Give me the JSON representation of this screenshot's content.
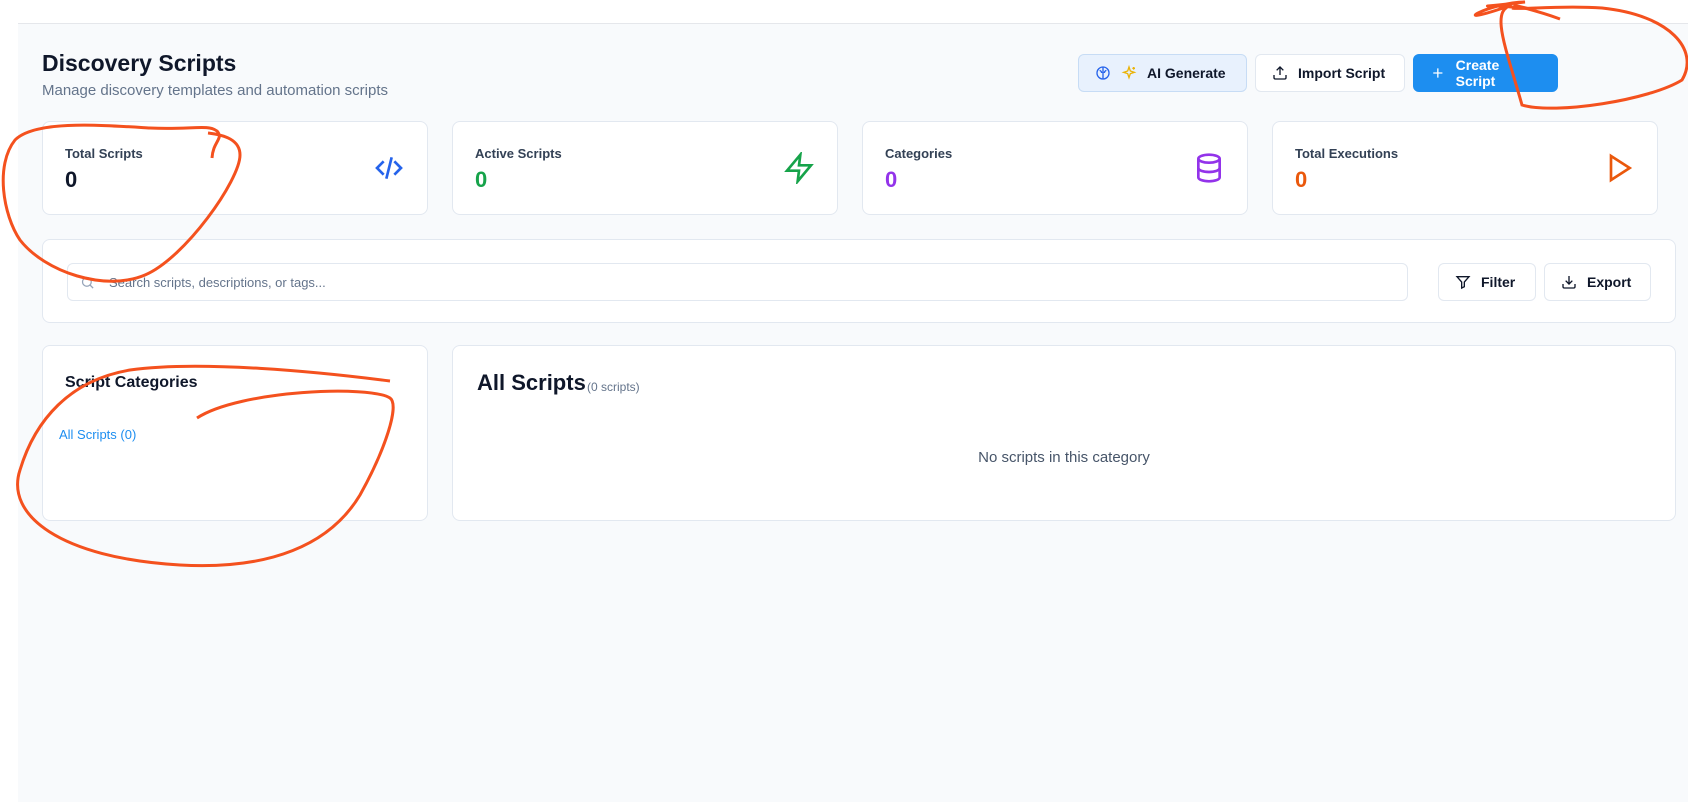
{
  "header": {
    "title": "Discovery Scripts",
    "subtitle": "Manage discovery templates and automation scripts"
  },
  "actions": {
    "ai_generate": "AI Generate",
    "import_script": "Import Script",
    "create_script": "Create Script"
  },
  "stats": [
    {
      "label": "Total Scripts",
      "value": "0",
      "color": "#0f172a",
      "icon": "code-icon",
      "icon_color": "#2563eb"
    },
    {
      "label": "Active Scripts",
      "value": "0",
      "color": "#16a34a",
      "icon": "zap-icon",
      "icon_color": "#16a34a"
    },
    {
      "label": "Categories",
      "value": "0",
      "color": "#9333ea",
      "icon": "database-icon",
      "icon_color": "#9333ea"
    },
    {
      "label": "Total Executions",
      "value": "0",
      "color": "#ea580c",
      "icon": "play-icon",
      "icon_color": "#ea580c"
    }
  ],
  "search": {
    "placeholder": "Search scripts, descriptions, or tags...",
    "value": ""
  },
  "toolbar": {
    "filter": "Filter",
    "export": "Export"
  },
  "categories": {
    "title": "Script Categories",
    "items": [
      {
        "label": "All Scripts (0)"
      }
    ]
  },
  "scripts": {
    "title": "All Scripts",
    "count": "(0 scripts)",
    "empty_message": "No scripts in this category"
  },
  "colors": {
    "accent": "#1d8ef0",
    "annotation": "#f4511e"
  }
}
